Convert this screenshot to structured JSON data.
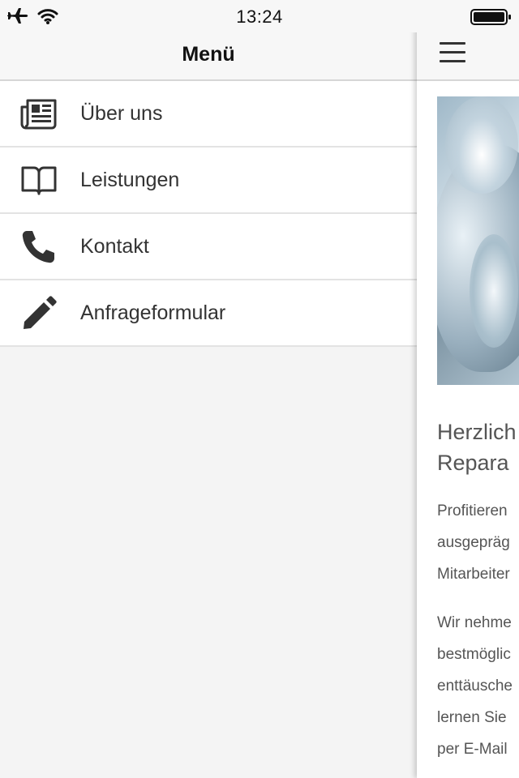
{
  "status_bar": {
    "time": "13:24",
    "icons": [
      "airplane-icon",
      "wifi-icon",
      "battery-icon"
    ]
  },
  "menu": {
    "title": "Menü",
    "items": [
      {
        "label": "Über uns",
        "icon": "newspaper-icon"
      },
      {
        "label": "Leistungen",
        "icon": "book-icon"
      },
      {
        "label": "Kontakt",
        "icon": "phone-icon"
      },
      {
        "label": "Anfrageformular",
        "icon": "pencil-icon"
      }
    ]
  },
  "content": {
    "nav_icon": "hamburger-menu-icon",
    "heading_lines": [
      "Herzlich",
      "Repara"
    ],
    "paragraph1_lines": [
      "Profitieren",
      "ausgepräg",
      "Mitarbeiter"
    ],
    "paragraph2_lines": [
      "Wir nehme",
      "bestmöglic",
      "enttäusche",
      "lernen Sie",
      "per E-Mail"
    ]
  },
  "colors": {
    "menu_background": "#f4f4f4",
    "header_background": "#f7f7f7",
    "text_dark": "#111111",
    "text_body": "#555555"
  }
}
